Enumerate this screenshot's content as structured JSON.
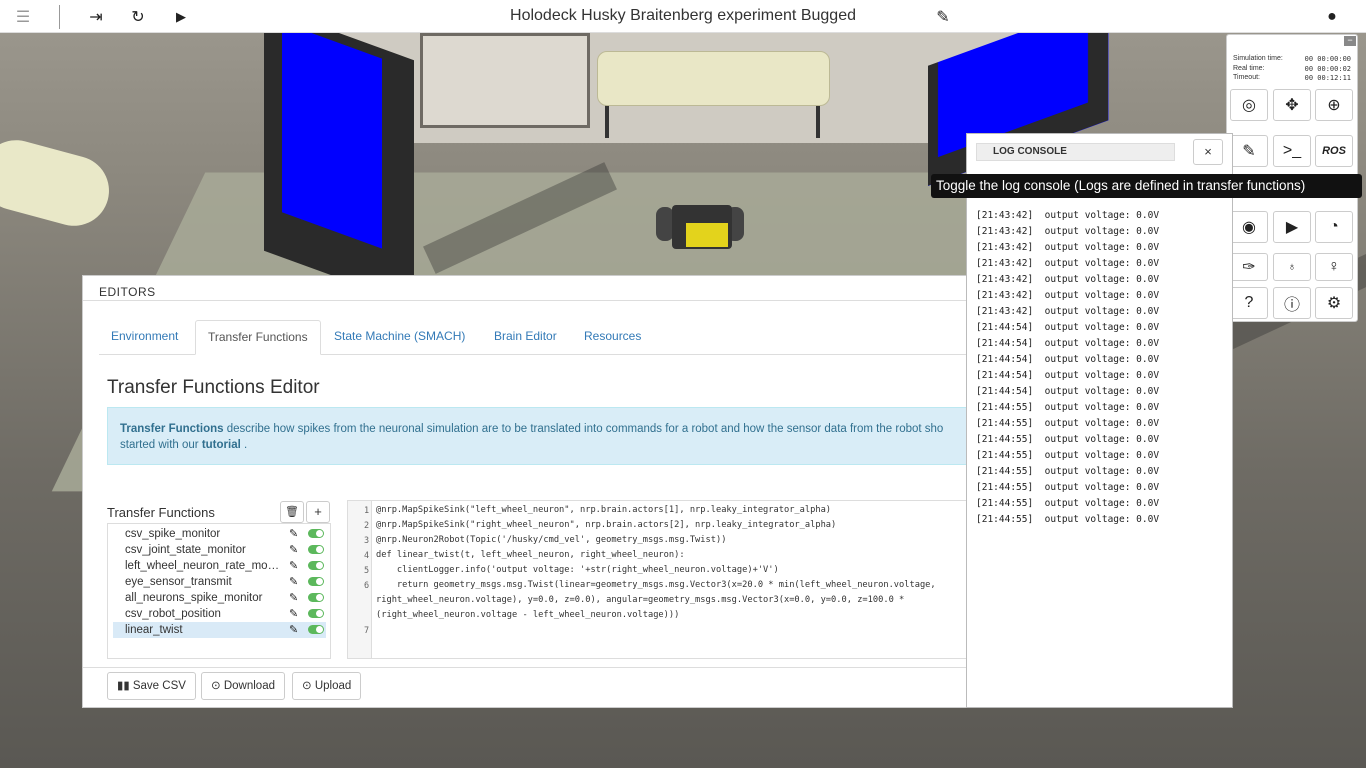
{
  "topbar": {
    "title": "Holodeck Husky Braitenberg experiment Bugged",
    "menu_icon": "☰",
    "exit_icon": "⇥",
    "reset_icon": "↻",
    "play_icon": "▶",
    "edit_icon": "✎",
    "user_icon": "●"
  },
  "editors": {
    "header": "EDITORS",
    "tabs": [
      "Environment",
      "Transfer Functions",
      "State Machine (SMACH)",
      "Brain Editor",
      "Resources"
    ],
    "title": "Transfer Functions Editor",
    "info": {
      "bold1": "Transfer Functions",
      "text1": " describe how spikes from the neuronal simulation are to be translated into commands for a robot and how the sensor data from the robot sho",
      "text2": "started with our ",
      "bold2": "tutorial",
      "text3": " ."
    },
    "list_label": "Transfer Functions",
    "delete_icon": "🗑",
    "add_icon": "+",
    "functions": [
      "csv_spike_monitor",
      "csv_joint_state_monitor",
      "left_wheel_neuron_rate_monitor",
      "eye_sensor_transmit",
      "all_neurons_spike_monitor",
      "csv_robot_position",
      "linear_twist"
    ],
    "selected": "linear_twist",
    "code_lines": [
      {
        "n": "1",
        "text": "@nrp.MapSpikeSink(\"left_wheel_neuron\", nrp.brain.actors[1], nrp.leaky_integrator_alpha)"
      },
      {
        "n": "2",
        "text": "@nrp.MapSpikeSink(\"right_wheel_neuron\", nrp.brain.actors[2], nrp.leaky_integrator_alpha)"
      },
      {
        "n": "3",
        "text": "@nrp.Neuron2Robot(Topic('/husky/cmd_vel', geometry_msgs.msg.Twist))"
      },
      {
        "n": "4",
        "text": "def linear_twist(t, left_wheel_neuron, right_wheel_neuron):"
      },
      {
        "n": "5",
        "text": "    clientLogger.info('output voltage: '+str(right_wheel_neuron.voltage)+'V')"
      },
      {
        "n": "6",
        "text": "    return geometry_msgs.msg.Twist(linear=geometry_msgs.msg.Vector3(x=20.0 * min(left_wheel_neuron.voltage,"
      },
      {
        "n": "",
        "text": "right_wheel_neuron.voltage), y=0.0, z=0.0), angular=geometry_msgs.msg.Vector3(x=0.0, y=0.0, z=100.0 *"
      },
      {
        "n": "",
        "text": "(right_wheel_neuron.voltage - left_wheel_neuron.voltage)))"
      },
      {
        "n": "7",
        "text": ""
      }
    ],
    "buttons": {
      "save_csv": "Save CSV",
      "download": "Download",
      "upload": "Upload"
    }
  },
  "log_console": {
    "title": "LOG CONSOLE",
    "close": "×",
    "tooltip": "Toggle the log console (Logs are defined in transfer functions)",
    "lines": [
      {
        "t": "[21:43:42]",
        "msg": "output voltage: 0.0V"
      },
      {
        "t": "[21:43:42]",
        "msg": "output voltage: 0.0V"
      },
      {
        "t": "[21:43:42]",
        "msg": "output voltage: 0.0V"
      },
      {
        "t": "[21:43:42]",
        "msg": "output voltage: 0.0V"
      },
      {
        "t": "[21:43:42]",
        "msg": "output voltage: 0.0V"
      },
      {
        "t": "[21:43:42]",
        "msg": "output voltage: 0.0V"
      },
      {
        "t": "[21:43:42]",
        "msg": "output voltage: 0.0V"
      },
      {
        "t": "[21:44:54]",
        "msg": "output voltage: 0.0V"
      },
      {
        "t": "[21:44:54]",
        "msg": "output voltage: 0.0V"
      },
      {
        "t": "[21:44:54]",
        "msg": "output voltage: 0.0V"
      },
      {
        "t": "[21:44:54]",
        "msg": "output voltage: 0.0V"
      },
      {
        "t": "[21:44:54]",
        "msg": "output voltage: 0.0V"
      },
      {
        "t": "[21:44:55]",
        "msg": "output voltage: 0.0V"
      },
      {
        "t": "[21:44:55]",
        "msg": "output voltage: 0.0V"
      },
      {
        "t": "[21:44:55]",
        "msg": "output voltage: 0.0V"
      },
      {
        "t": "[21:44:55]",
        "msg": "output voltage: 0.0V"
      },
      {
        "t": "[21:44:55]",
        "msg": "output voltage: 0.0V"
      },
      {
        "t": "[21:44:55]",
        "msg": "output voltage: 0.0V"
      },
      {
        "t": "[21:44:55]",
        "msg": "output voltage: 0.0V"
      },
      {
        "t": "[21:44:55]",
        "msg": "output voltage: 0.0V"
      }
    ]
  },
  "control_panel": {
    "sim_time_label": "Simulation time:",
    "sim_time": "00 00:00:00",
    "real_time_label": "Real time:",
    "real_time": "00 00:00:02",
    "timeout_label": "Timeout:",
    "timeout": "00 00:12:11",
    "ros_label": "ROS"
  }
}
